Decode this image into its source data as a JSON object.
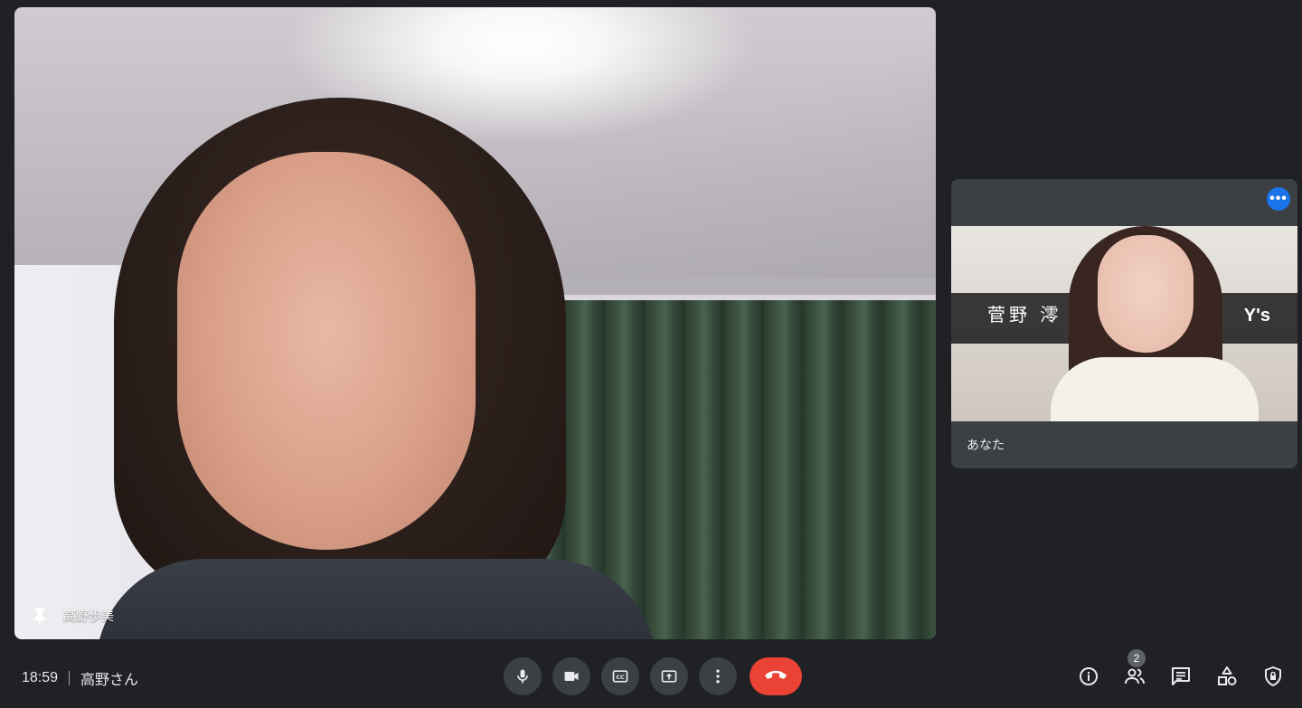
{
  "main_video": {
    "participant_name": "高野歩美"
  },
  "self_video": {
    "name_label": "あなた",
    "banner_name": "菅野 澪",
    "banner_brand": "Y's",
    "more_label": "•••"
  },
  "bottom_bar": {
    "time": "18:59",
    "meeting_name": "高野さん",
    "participant_count": "2"
  },
  "icons": {
    "pin": "pin-icon",
    "mic": "microphone-icon",
    "camera": "video-camera-icon",
    "captions": "closed-captions-icon",
    "present": "present-screen-icon",
    "more": "more-vertical-icon",
    "end": "end-call-icon",
    "info": "info-icon",
    "people": "people-icon",
    "chat": "chat-icon",
    "activities": "activities-icon",
    "host": "host-controls-icon"
  },
  "colors": {
    "background": "#202124",
    "tile": "#3c4043",
    "end_call": "#ea4335",
    "accent": "#1a73e8"
  }
}
